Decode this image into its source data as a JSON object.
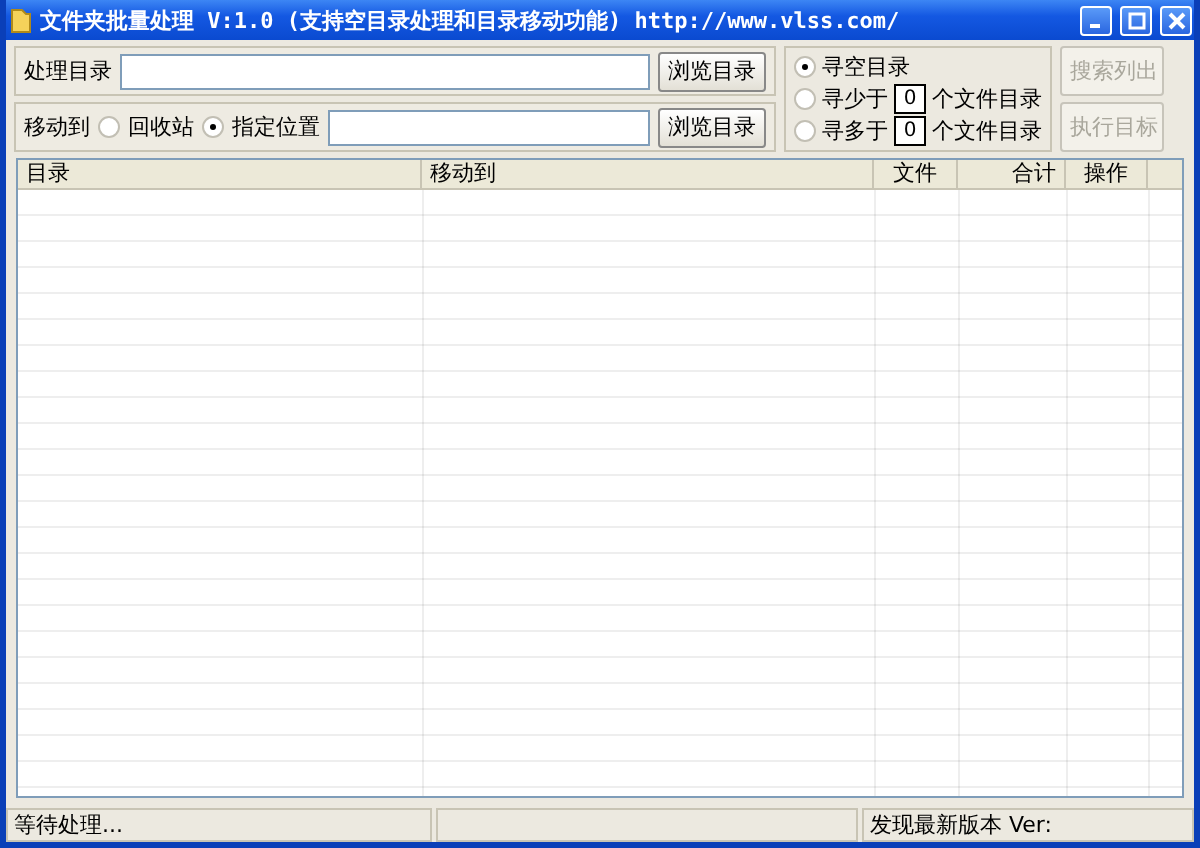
{
  "window": {
    "title": "文件夹批量处理 V:1.0 (支持空目录处理和目录移动功能) http://www.vlss.com/"
  },
  "source": {
    "label": "处理目录",
    "browse": "浏览目录"
  },
  "move": {
    "label": "移动到",
    "options": [
      {
        "label": "回收站",
        "selected": false
      },
      {
        "label": "指定位置",
        "selected": true
      }
    ],
    "browse": "浏览目录"
  },
  "search_modes": [
    {
      "kind": "plain",
      "label": "寻空目录",
      "selected": true
    },
    {
      "kind": "count",
      "prefix": "寻少于",
      "value": "0",
      "suffix": "个文件目录",
      "selected": false
    },
    {
      "kind": "count",
      "prefix": "寻多于",
      "value": "0",
      "suffix": "个文件目录",
      "selected": false
    }
  ],
  "actions": [
    {
      "label": "搜索列出",
      "disabled": true
    },
    {
      "label": "执行目标",
      "disabled": true
    }
  ],
  "table": {
    "columns": [
      "目录",
      "移动到",
      "文件",
      "合计",
      "操作"
    ]
  },
  "status_bar": {
    "left": "等待处理...",
    "right": "发现最新版本 Ver:"
  }
}
